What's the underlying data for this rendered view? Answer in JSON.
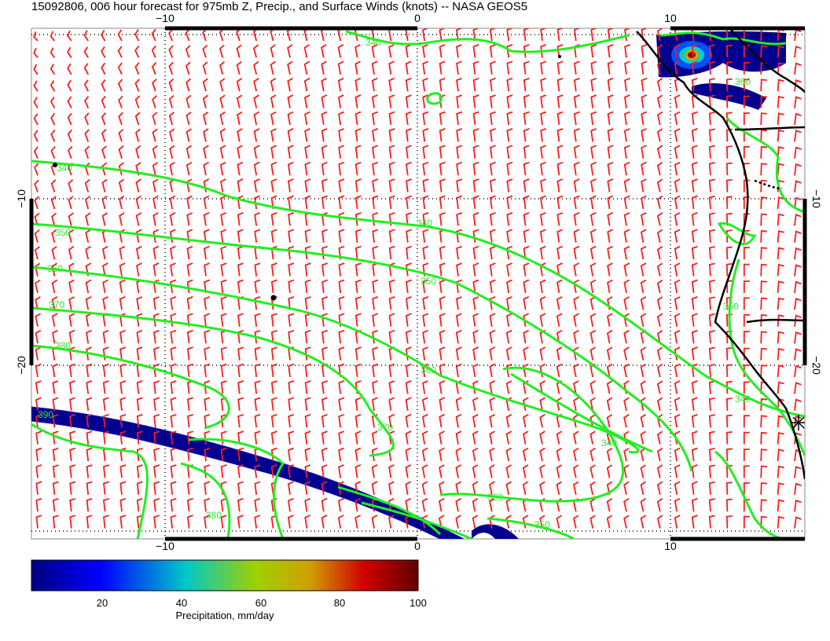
{
  "title": "15092806, 006 hour forecast for 975mb Z, Precip., and Surface Winds (knots) -- NASA GEOS5",
  "colors": {
    "wind_barb": "#ff1a1a",
    "contour": "#22ee22",
    "coast": "#000000",
    "grid": "#000000"
  },
  "axes": {
    "x_ticks": [
      "−10",
      "0",
      "10"
    ],
    "y_ticks": [
      "−10",
      "−20"
    ]
  },
  "contour_labels": [
    "340",
    "350",
    "360",
    "370",
    "380",
    "390",
    "340",
    "350",
    "360",
    "370",
    "380",
    "340",
    "350",
    "360"
  ],
  "colorbar": {
    "label": "Precipitation, mm/day",
    "ticks": [
      "20",
      "40",
      "60",
      "80",
      "100"
    ],
    "colors": [
      "#000080",
      "#0000ff",
      "#00c8c8",
      "#a0d000",
      "#d0a000",
      "#d00000",
      "#600000"
    ]
  },
  "icons": [
    "wind-barb-icon",
    "station-marker-icon"
  ]
}
